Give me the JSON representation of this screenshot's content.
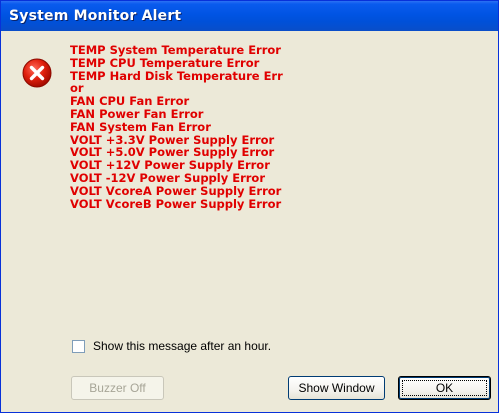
{
  "window": {
    "title": "System Monitor Alert"
  },
  "icon": "error-icon",
  "messages": [
    "TEMP System Temperature Error",
    "TEMP CPU Temperature Error",
    "TEMP Hard Disk Temperature Err",
    "or",
    "FAN CPU Fan Error",
    "FAN Power Fan Error",
    "FAN System Fan Error",
    "VOLT +3.3V Power Supply Error",
    "VOLT +5.0V Power Supply Error",
    "VOLT +12V Power Supply Error",
    "VOLT -12V Power Supply Error",
    "VOLT VcoreA Power Supply Error",
    "VOLT VcoreB Power Supply Error"
  ],
  "checkbox": {
    "label": "Show this message after an hour.",
    "checked": false
  },
  "buttons": {
    "buzzer_off": "Buzzer Off",
    "show_window": "Show Window",
    "ok": "OK"
  },
  "colors": {
    "title_bar": "#0054e3",
    "message_text": "#e00000",
    "background": "#ece9d8"
  }
}
